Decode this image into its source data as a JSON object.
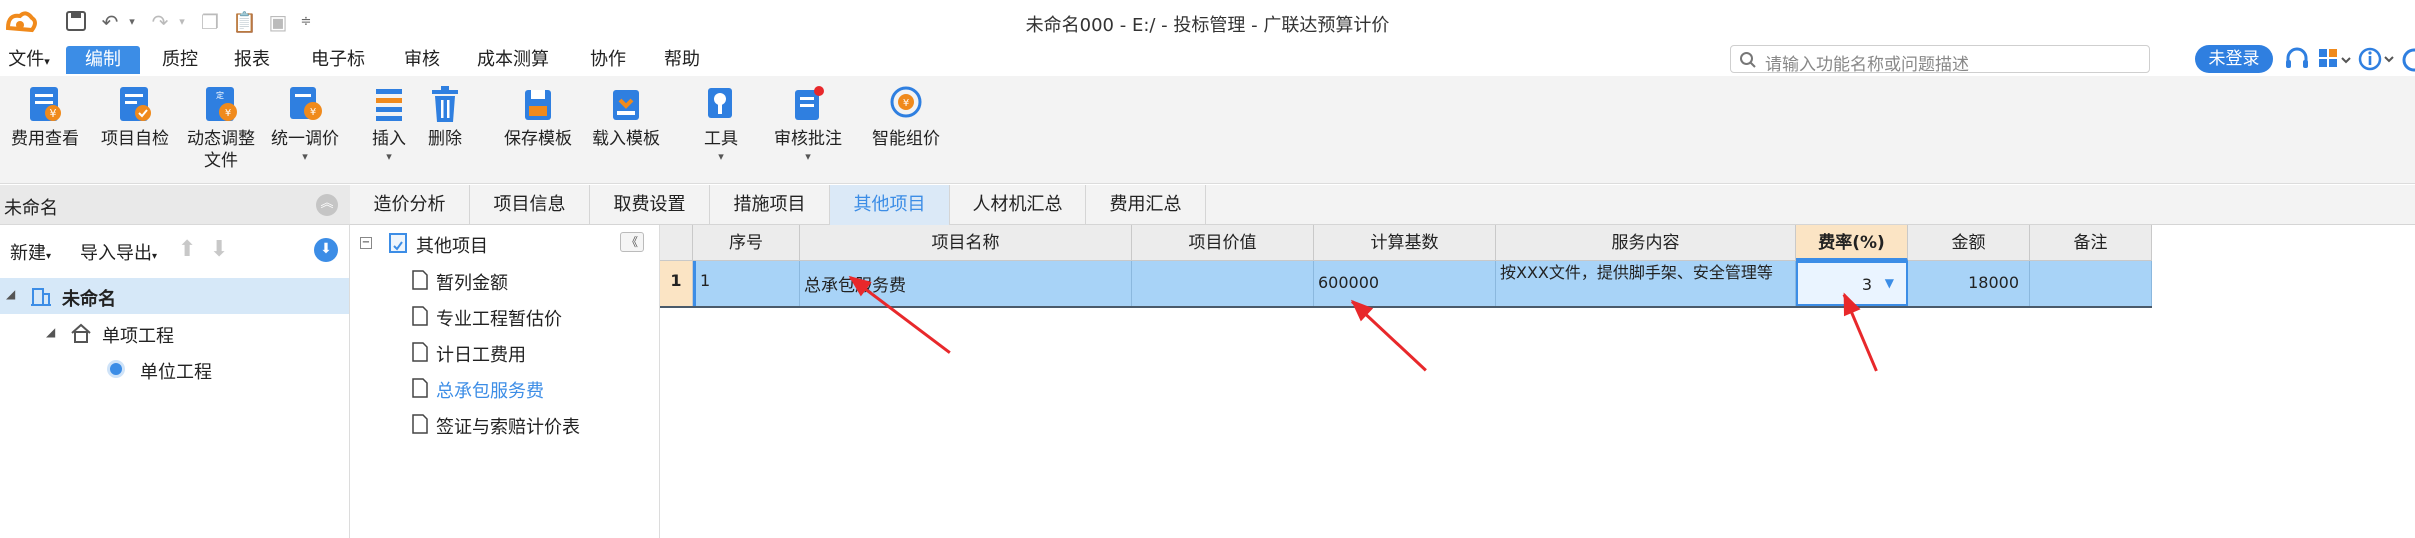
{
  "window": {
    "title": "未命名000 - E:/ - 投标管理 - 广联达预算计价"
  },
  "menu": [
    {
      "label": "文件"
    },
    {
      "label": "编制"
    },
    {
      "label": "质控"
    },
    {
      "label": "报表"
    },
    {
      "label": "电子标"
    },
    {
      "label": "审核"
    },
    {
      "label": "成本测算"
    },
    {
      "label": "协作"
    },
    {
      "label": "帮助"
    }
  ],
  "search": {
    "placeholder": "请输入功能名称或问题描述"
  },
  "login_label": "未登录",
  "ribbon": [
    {
      "label": "费用查看",
      "icon": "fee-view-icon"
    },
    {
      "label": "项目自检",
      "icon": "project-check-icon"
    },
    {
      "label": "动态调整",
      "label2": "文件",
      "icon": "dynamic-adjust-icon"
    },
    {
      "label": "统一调价",
      "icon": "unified-price-icon"
    },
    {
      "label": "插入",
      "icon": "insert-icon"
    },
    {
      "label": "删除",
      "icon": "delete-icon"
    },
    {
      "label": "保存模板",
      "icon": "save-template-icon"
    },
    {
      "label": "载入模板",
      "icon": "load-template-icon"
    },
    {
      "label": "工具",
      "icon": "tools-icon"
    },
    {
      "label": "审核批注",
      "icon": "review-annotation-icon"
    },
    {
      "label": "智能组价",
      "icon": "smart-pricing-icon"
    }
  ],
  "left_panel": {
    "header": "未命名",
    "new_label": "新建",
    "import_export_label": "导入导出",
    "tree": [
      {
        "label": "未命名",
        "level": 0
      },
      {
        "label": "单项工程",
        "level": 1
      },
      {
        "label": "单位工程",
        "level": 2
      }
    ]
  },
  "tabs": [
    {
      "label": "造价分析"
    },
    {
      "label": "项目信息"
    },
    {
      "label": "取费设置"
    },
    {
      "label": "措施项目"
    },
    {
      "label": "其他项目"
    },
    {
      "label": "人材机汇总"
    },
    {
      "label": "费用汇总"
    }
  ],
  "other_tree": {
    "root": "其他项目",
    "items": [
      "暂列金额",
      "专业工程暂估价",
      "计日工费用",
      "总承包服务费",
      "签证与索赔计价表"
    ]
  },
  "grid": {
    "headers": [
      "序号",
      "项目名称",
      "项目价值",
      "计算基数",
      "服务内容",
      "费率(%)",
      "金额",
      "备注"
    ],
    "rows": [
      {
        "row_num": "1",
        "seq": "1",
        "name": "总承包服务费",
        "value": "",
        "base": "600000",
        "content": "按XXX文件，提供脚手架、安全管理等",
        "rate": "3",
        "amount": "18000",
        "note": ""
      }
    ]
  },
  "colors": {
    "accent": "#3c8de6",
    "selected_row": "#a8d3f7",
    "arrow": "#e8282b"
  }
}
